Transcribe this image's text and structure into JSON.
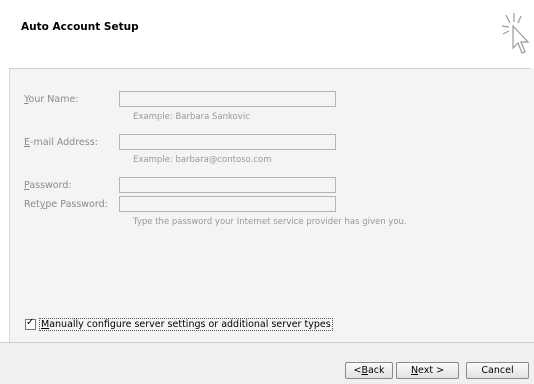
{
  "header": {
    "title": "Auto Account Setup",
    "icon": "pointer-cursor-icon"
  },
  "form": {
    "name": {
      "label": "Your Name:",
      "value": "",
      "hint": "Example: Barbara Sankovic"
    },
    "email": {
      "label": "E-mail Address:",
      "value": "",
      "hint": "Example: barbara@contoso.com"
    },
    "password": {
      "label": "Password:",
      "value": ""
    },
    "retype": {
      "label": "Retype Password:",
      "value": "",
      "hint": "Type the password your Internet service provider has given you."
    }
  },
  "manual_config": {
    "label": "Manually configure server settings or additional server types",
    "checked": true
  },
  "buttons": {
    "back": "< Back",
    "next": "Next >",
    "cancel": "Cancel"
  },
  "colors": {
    "disabled_text": "#8a8a8a",
    "hint_text": "#999999"
  }
}
